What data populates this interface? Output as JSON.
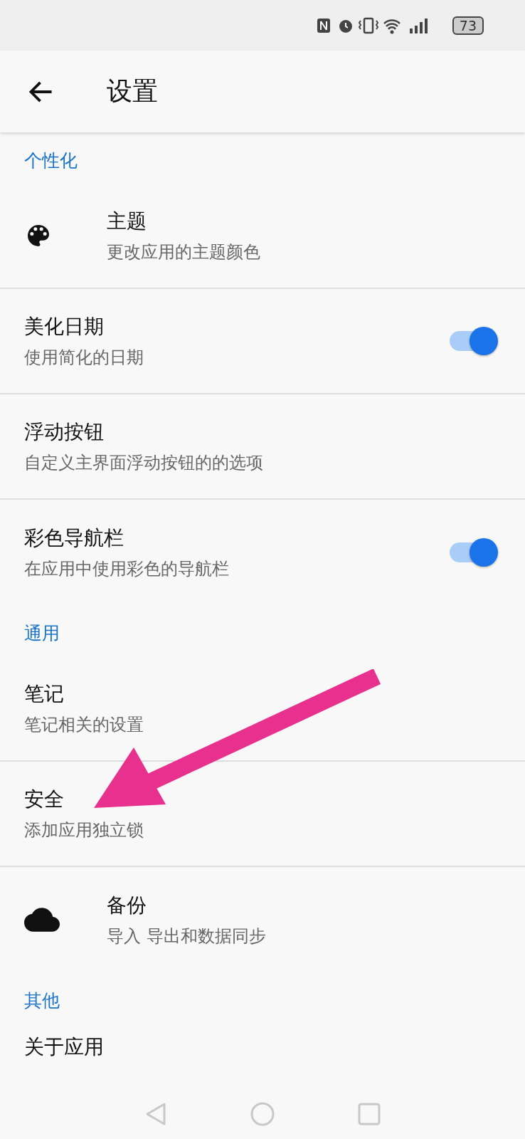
{
  "status_bar": {
    "battery": "73"
  },
  "app_bar": {
    "title": "设置"
  },
  "sections": [
    {
      "header": "个性化",
      "items": [
        {
          "kind": "palette",
          "title": "主题",
          "subtitle": "更改应用的主题颜色"
        },
        {
          "kind": "switch",
          "title": "美化日期",
          "subtitle": "使用简化的日期",
          "on": true
        },
        {
          "kind": "plain",
          "title": "浮动按钮",
          "subtitle": "自定义主界面浮动按钮的的选项"
        },
        {
          "kind": "switch",
          "title": "彩色导航栏",
          "subtitle": "在应用中使用彩色的导航栏",
          "on": true
        }
      ]
    },
    {
      "header": "通用",
      "items": [
        {
          "kind": "plain",
          "title": "笔记",
          "subtitle": "笔记相关的设置"
        },
        {
          "kind": "plain",
          "title": "安全",
          "subtitle": "添加应用独立锁"
        },
        {
          "kind": "cloud",
          "title": "备份",
          "subtitle": "导入 导出和数据同步"
        }
      ]
    },
    {
      "header": "其他",
      "items": [
        {
          "kind": "plain",
          "title": "关于应用"
        }
      ]
    }
  ]
}
